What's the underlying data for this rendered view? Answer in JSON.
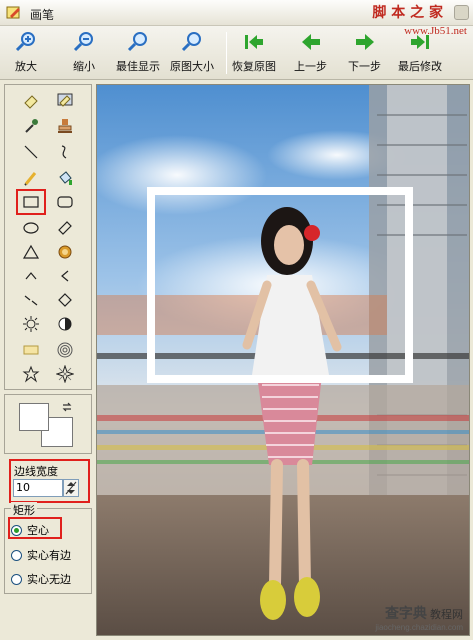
{
  "window": {
    "title": "画笔",
    "watermark_text": "脚 本 之 家",
    "watermark_url": "www.Jb51.net"
  },
  "toolbar": {
    "zoom_in": "放大",
    "zoom_out": "缩小",
    "best_fit": "最佳显示",
    "original_size": "原图大小",
    "restore_original": "恢复原图",
    "undo": "上一步",
    "redo": "下一步",
    "last_edit": "最后修改"
  },
  "tools": {
    "selected": "rectangle-tool"
  },
  "line_width": {
    "label": "边线宽度",
    "value": "10"
  },
  "shape_group": {
    "title": "矩形",
    "options": [
      "空心",
      "实心有边",
      "实心无边"
    ],
    "selected": "空心"
  },
  "canvas_watermark": {
    "title": "查字典",
    "subtitle": "教程网",
    "url": "jiaocheng.chazidian.com"
  },
  "colors": {
    "accent_red": "#e0201c",
    "arrow_green": "#2ea52e",
    "magnifier_blue": "#2a6fc2"
  }
}
